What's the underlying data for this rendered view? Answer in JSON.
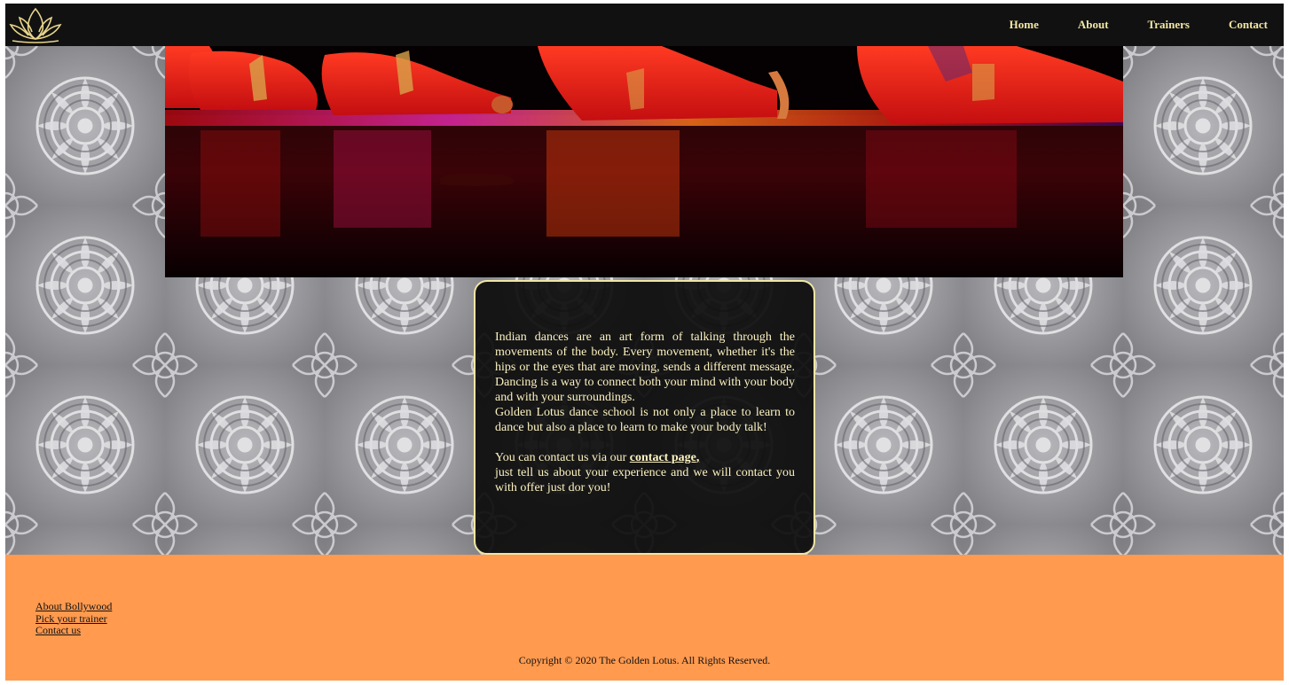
{
  "colors": {
    "nav_bg": "#111111",
    "nav_text": "#f3e7a6",
    "card_border": "#efe6a4",
    "card_text": "#fdf3c0",
    "footer_bg": "#ff9a4f",
    "pattern_base": "#8f8f93"
  },
  "header": {
    "logo_icon": "lotus-logo-icon",
    "nav": [
      {
        "label": "Home"
      },
      {
        "label": "About"
      },
      {
        "label": "Trainers"
      },
      {
        "label": "Contact"
      }
    ]
  },
  "hero": {
    "image_icon": "dancers-stage-photo"
  },
  "card": {
    "paragraph1": "Indian dances are an art form of talking through the movements of the body. Every movement, whether it's the hips or the eyes that are moving, sends a different message. Dancing is a way to connect both your mind with your body and with your surroundings.",
    "paragraph2": "Golden Lotus dance school is not only a place to learn to dance but also a place to learn to make your body talk!",
    "contact_prefix": "You can contact us via our ",
    "contact_link": "contact page",
    "contact_comma": ",",
    "contact_suffix": "just tell us about your experience and we will contact you with offer just dor you!"
  },
  "footer": {
    "links": [
      {
        "label": "About Bollywood"
      },
      {
        "label": "Pick your trainer"
      },
      {
        "label": "Contact us"
      }
    ],
    "copyright": "Copyright © 2020 The Golden Lotus. All Rights Reserved."
  }
}
